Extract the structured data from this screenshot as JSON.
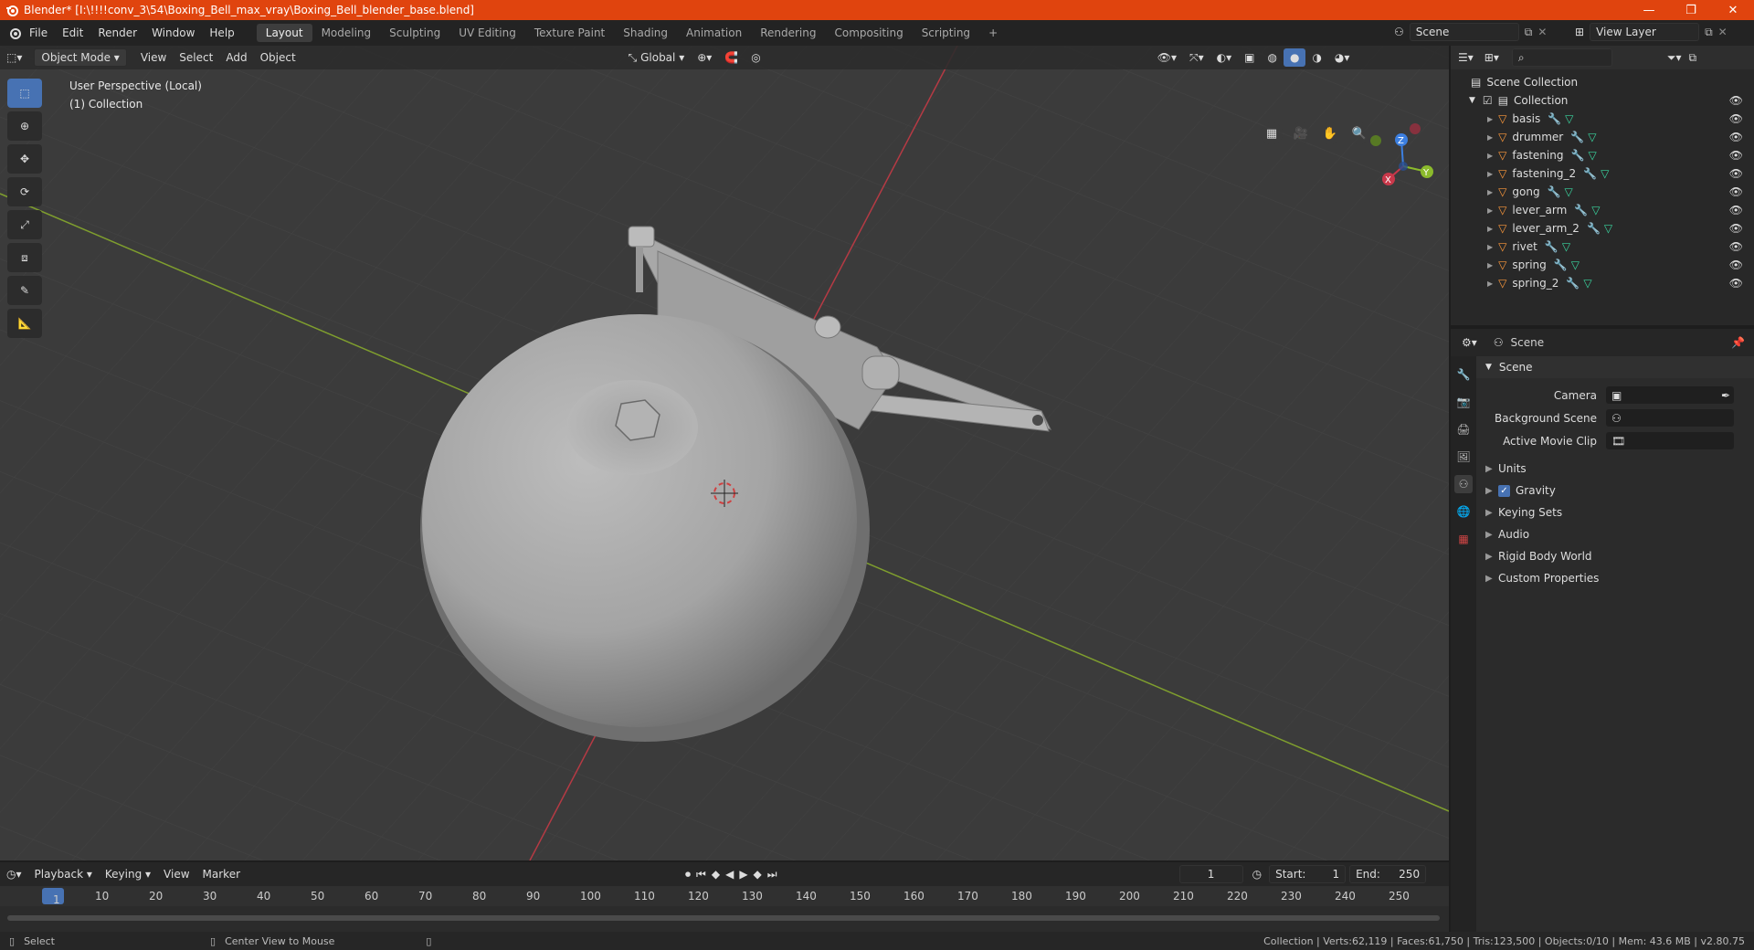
{
  "window": {
    "title": "Blender* [I:\\!!!!conv_3\\54\\Boxing_Bell_max_vray\\Boxing_Bell_blender_base.blend]",
    "min": "—",
    "max": "❐",
    "close": "✕"
  },
  "menu": [
    "File",
    "Edit",
    "Render",
    "Window",
    "Help"
  ],
  "workspace_tabs": [
    "Layout",
    "Modeling",
    "Sculpting",
    "UV Editing",
    "Texture Paint",
    "Shading",
    "Animation",
    "Rendering",
    "Compositing",
    "Scripting"
  ],
  "active_tab": "Layout",
  "scene_name": "Scene",
  "view_layer": "View Layer",
  "viewport": {
    "mode": "Object Mode",
    "menus": [
      "View",
      "Select",
      "Add",
      "Object"
    ],
    "orientation": "Global",
    "perspective": "User Perspective (Local)",
    "collection": "(1) Collection"
  },
  "gizmo": {
    "z": "Z",
    "y": "Y",
    "x": "X"
  },
  "outliner": {
    "root": "Scene Collection",
    "collection": "Collection",
    "items": [
      "basis",
      "drummer",
      "fastening",
      "fastening_2",
      "gong",
      "lever_arm",
      "lever_arm_2",
      "rivet",
      "spring",
      "spring_2"
    ]
  },
  "properties": {
    "context": "Scene",
    "panel": "Scene",
    "camera_label": "Camera",
    "bg_scene_label": "Background Scene",
    "movie_clip_label": "Active Movie Clip",
    "sections": [
      "Units",
      "Gravity",
      "Keying Sets",
      "Audio",
      "Rigid Body World",
      "Custom Properties"
    ]
  },
  "timeline": {
    "menus": [
      "Playback",
      "Keying",
      "View",
      "Marker"
    ],
    "current_frame": "1",
    "start_label": "Start:",
    "start": "1",
    "end_label": "End:",
    "end": "250",
    "ticks": [
      "10",
      "20",
      "30",
      "40",
      "50",
      "60",
      "70",
      "80",
      "90",
      "100",
      "110",
      "120",
      "130",
      "140",
      "150",
      "160",
      "170",
      "180",
      "190",
      "200",
      "210",
      "220",
      "230",
      "240",
      "250"
    ]
  },
  "status": {
    "left": "Select",
    "middle": "Center View to Mouse",
    "right": "Collection | Verts:62,119 | Faces:61,750 | Tris:123,500 | Objects:0/10 | Mem: 43.6 MB | v2.80.75"
  },
  "colors": {
    "title_bar": "#e0440e",
    "accent": "#4772b3",
    "x_axis": "#c9384a",
    "y_axis": "#8bba2c"
  }
}
